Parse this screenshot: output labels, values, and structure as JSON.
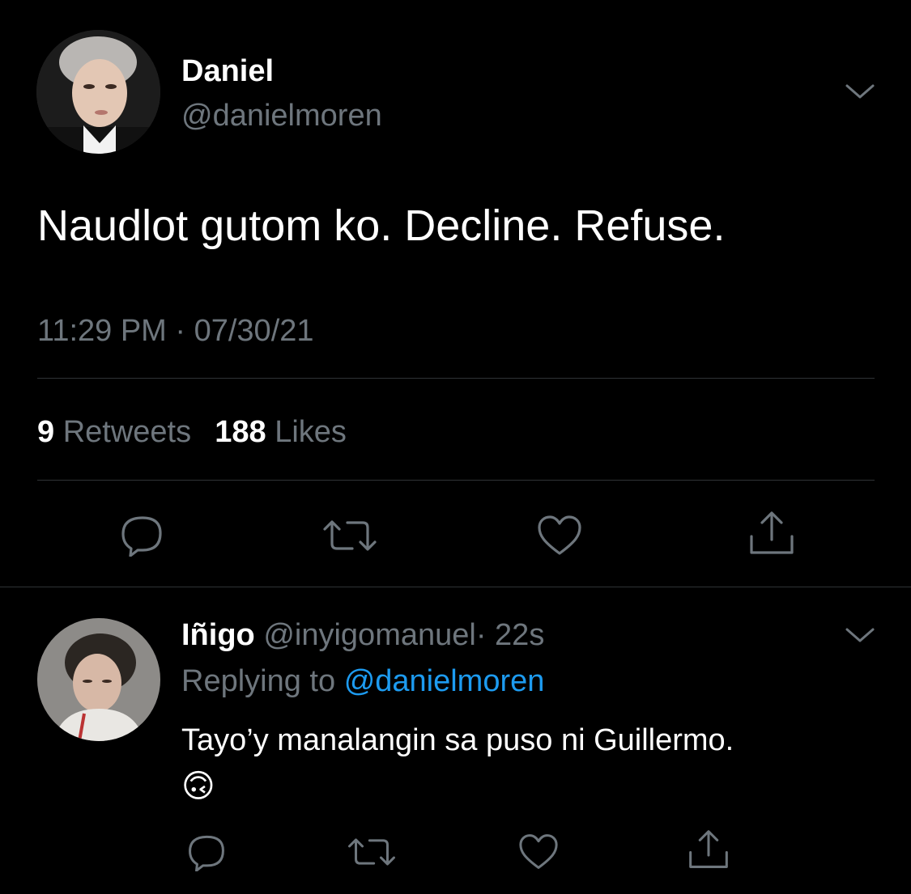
{
  "main_tweet": {
    "author_name": "Daniel",
    "author_handle": "@danielmoren",
    "text": "Naudlot gutom ko. Decline. Refuse.",
    "timestamp": "11:29 PM · 07/30/21",
    "retweet_count": "9",
    "retweet_label": "Retweets",
    "like_count": "188",
    "like_label": "Likes"
  },
  "reply": {
    "author_name": "Iñigo",
    "author_handle": "@inyigomanuel",
    "time_sep": "·",
    "time": "22s",
    "replying_label": "Replying to",
    "replying_handle": "@danielmoren",
    "text": "Tayo’y manalangin sa puso ni Guillermo.",
    "emoji": "🙃"
  },
  "icons": [
    "chevron-down-icon",
    "reply-icon",
    "retweet-icon",
    "like-icon",
    "share-icon"
  ],
  "colors": {
    "background": "#000000",
    "text": "#ffffff",
    "secondary_text": "#6e767d",
    "link": "#1d9bf0",
    "divider": "#2f3336"
  }
}
